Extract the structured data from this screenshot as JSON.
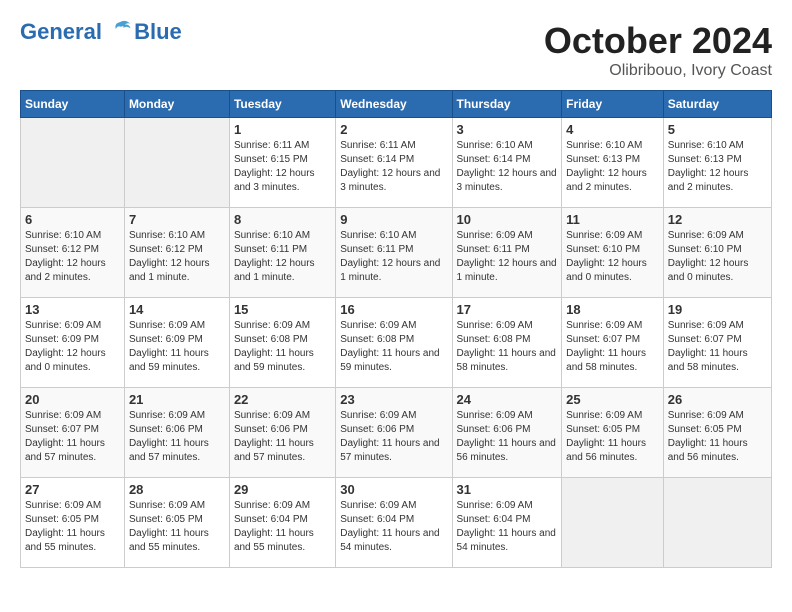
{
  "logo": {
    "line1": "General",
    "line2": "Blue"
  },
  "title": "October 2024",
  "subtitle": "Olibribouo, Ivory Coast",
  "weekdays": [
    "Sunday",
    "Monday",
    "Tuesday",
    "Wednesday",
    "Thursday",
    "Friday",
    "Saturday"
  ],
  "weeks": [
    [
      {
        "day": "",
        "info": ""
      },
      {
        "day": "",
        "info": ""
      },
      {
        "day": "1",
        "info": "Sunrise: 6:11 AM\nSunset: 6:15 PM\nDaylight: 12 hours and 3 minutes."
      },
      {
        "day": "2",
        "info": "Sunrise: 6:11 AM\nSunset: 6:14 PM\nDaylight: 12 hours and 3 minutes."
      },
      {
        "day": "3",
        "info": "Sunrise: 6:10 AM\nSunset: 6:14 PM\nDaylight: 12 hours and 3 minutes."
      },
      {
        "day": "4",
        "info": "Sunrise: 6:10 AM\nSunset: 6:13 PM\nDaylight: 12 hours and 2 minutes."
      },
      {
        "day": "5",
        "info": "Sunrise: 6:10 AM\nSunset: 6:13 PM\nDaylight: 12 hours and 2 minutes."
      }
    ],
    [
      {
        "day": "6",
        "info": "Sunrise: 6:10 AM\nSunset: 6:12 PM\nDaylight: 12 hours and 2 minutes."
      },
      {
        "day": "7",
        "info": "Sunrise: 6:10 AM\nSunset: 6:12 PM\nDaylight: 12 hours and 1 minute."
      },
      {
        "day": "8",
        "info": "Sunrise: 6:10 AM\nSunset: 6:11 PM\nDaylight: 12 hours and 1 minute."
      },
      {
        "day": "9",
        "info": "Sunrise: 6:10 AM\nSunset: 6:11 PM\nDaylight: 12 hours and 1 minute."
      },
      {
        "day": "10",
        "info": "Sunrise: 6:09 AM\nSunset: 6:11 PM\nDaylight: 12 hours and 1 minute."
      },
      {
        "day": "11",
        "info": "Sunrise: 6:09 AM\nSunset: 6:10 PM\nDaylight: 12 hours and 0 minutes."
      },
      {
        "day": "12",
        "info": "Sunrise: 6:09 AM\nSunset: 6:10 PM\nDaylight: 12 hours and 0 minutes."
      }
    ],
    [
      {
        "day": "13",
        "info": "Sunrise: 6:09 AM\nSunset: 6:09 PM\nDaylight: 12 hours and 0 minutes."
      },
      {
        "day": "14",
        "info": "Sunrise: 6:09 AM\nSunset: 6:09 PM\nDaylight: 11 hours and 59 minutes."
      },
      {
        "day": "15",
        "info": "Sunrise: 6:09 AM\nSunset: 6:08 PM\nDaylight: 11 hours and 59 minutes."
      },
      {
        "day": "16",
        "info": "Sunrise: 6:09 AM\nSunset: 6:08 PM\nDaylight: 11 hours and 59 minutes."
      },
      {
        "day": "17",
        "info": "Sunrise: 6:09 AM\nSunset: 6:08 PM\nDaylight: 11 hours and 58 minutes."
      },
      {
        "day": "18",
        "info": "Sunrise: 6:09 AM\nSunset: 6:07 PM\nDaylight: 11 hours and 58 minutes."
      },
      {
        "day": "19",
        "info": "Sunrise: 6:09 AM\nSunset: 6:07 PM\nDaylight: 11 hours and 58 minutes."
      }
    ],
    [
      {
        "day": "20",
        "info": "Sunrise: 6:09 AM\nSunset: 6:07 PM\nDaylight: 11 hours and 57 minutes."
      },
      {
        "day": "21",
        "info": "Sunrise: 6:09 AM\nSunset: 6:06 PM\nDaylight: 11 hours and 57 minutes."
      },
      {
        "day": "22",
        "info": "Sunrise: 6:09 AM\nSunset: 6:06 PM\nDaylight: 11 hours and 57 minutes."
      },
      {
        "day": "23",
        "info": "Sunrise: 6:09 AM\nSunset: 6:06 PM\nDaylight: 11 hours and 57 minutes."
      },
      {
        "day": "24",
        "info": "Sunrise: 6:09 AM\nSunset: 6:06 PM\nDaylight: 11 hours and 56 minutes."
      },
      {
        "day": "25",
        "info": "Sunrise: 6:09 AM\nSunset: 6:05 PM\nDaylight: 11 hours and 56 minutes."
      },
      {
        "day": "26",
        "info": "Sunrise: 6:09 AM\nSunset: 6:05 PM\nDaylight: 11 hours and 56 minutes."
      }
    ],
    [
      {
        "day": "27",
        "info": "Sunrise: 6:09 AM\nSunset: 6:05 PM\nDaylight: 11 hours and 55 minutes."
      },
      {
        "day": "28",
        "info": "Sunrise: 6:09 AM\nSunset: 6:05 PM\nDaylight: 11 hours and 55 minutes."
      },
      {
        "day": "29",
        "info": "Sunrise: 6:09 AM\nSunset: 6:04 PM\nDaylight: 11 hours and 55 minutes."
      },
      {
        "day": "30",
        "info": "Sunrise: 6:09 AM\nSunset: 6:04 PM\nDaylight: 11 hours and 54 minutes."
      },
      {
        "day": "31",
        "info": "Sunrise: 6:09 AM\nSunset: 6:04 PM\nDaylight: 11 hours and 54 minutes."
      },
      {
        "day": "",
        "info": ""
      },
      {
        "day": "",
        "info": ""
      }
    ]
  ]
}
